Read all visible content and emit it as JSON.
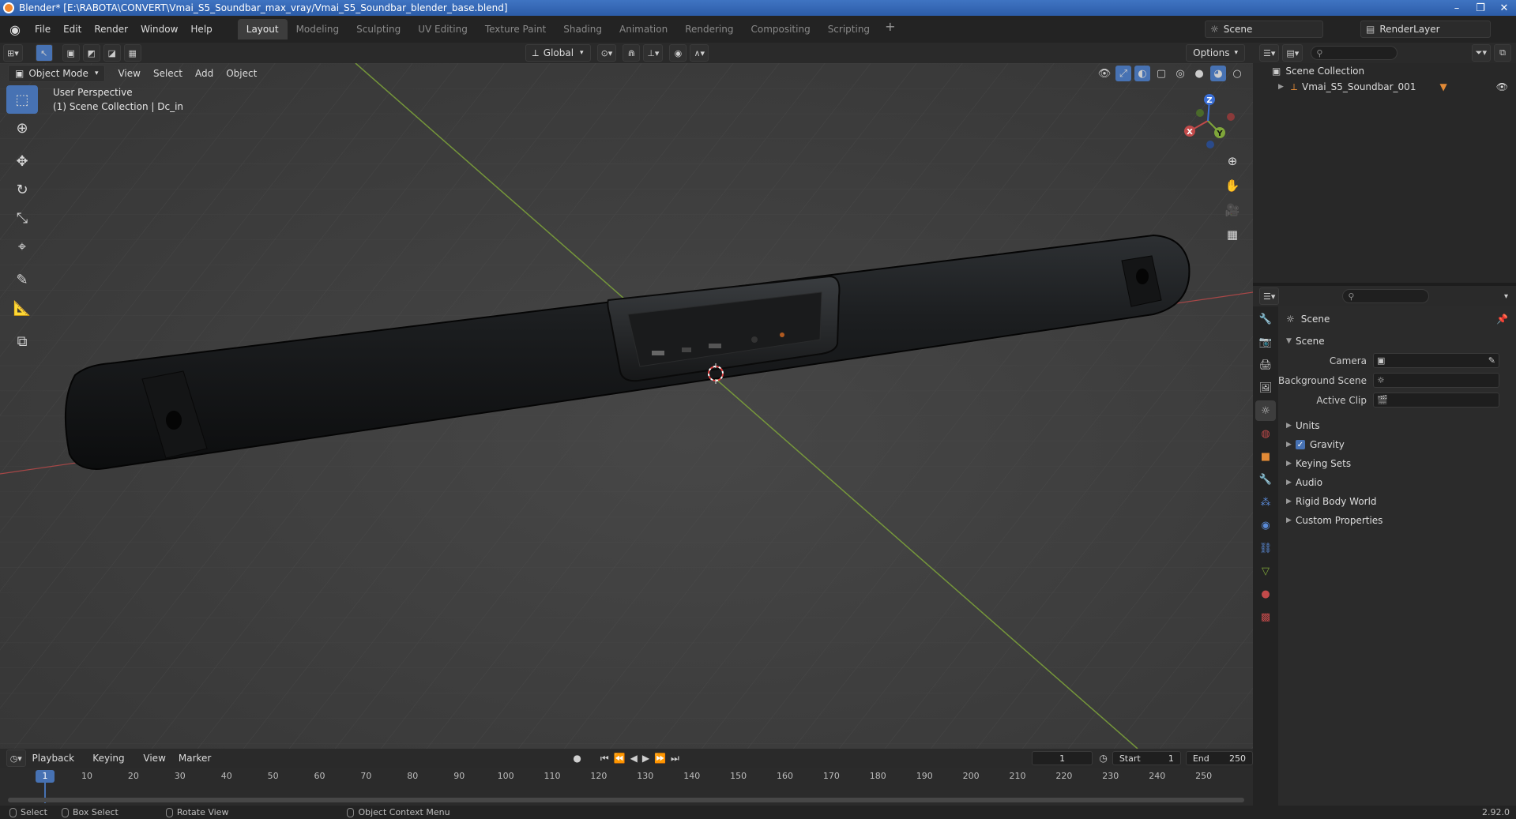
{
  "window": {
    "title": "Blender* [E:\\RABOTA\\CONVERT\\Vmai_S5_Soundbar_max_vray/Vmai_S5_Soundbar_blender_base.blend]",
    "controls": [
      "–",
      "❐",
      "✕"
    ]
  },
  "menubar": {
    "items": [
      "File",
      "Edit",
      "Render",
      "Window",
      "Help"
    ],
    "workspaces": [
      "Layout",
      "Modeling",
      "Sculpting",
      "UV Editing",
      "Texture Paint",
      "Shading",
      "Animation",
      "Rendering",
      "Compositing",
      "Scripting"
    ],
    "active_workspace": "Layout",
    "add_label": "+",
    "scene": "Scene",
    "render_layer": "RenderLayer"
  },
  "viewport_header": {
    "orientation": "Global",
    "options_label": "Options"
  },
  "viewport": {
    "mode": "Object Mode",
    "menus": [
      "View",
      "Select",
      "Add",
      "Object"
    ],
    "info_line1": "User Perspective",
    "info_line2": "(1) Scene Collection | Dc_in",
    "gizmo": {
      "x": "X",
      "y": "Y",
      "z": "Z"
    }
  },
  "outliner": {
    "collection": "Scene Collection",
    "object": "Vmai_S5_Soundbar_001"
  },
  "properties": {
    "context": "Scene",
    "panel": "Scene",
    "rows": [
      {
        "label": "Camera",
        "value": ""
      },
      {
        "label": "Background Scene",
        "value": ""
      },
      {
        "label": "Active Clip",
        "value": ""
      }
    ],
    "subpanels": [
      "Units",
      "Gravity",
      "Keying Sets",
      "Audio",
      "Rigid Body World",
      "Custom Properties"
    ],
    "gravity_checked": true
  },
  "timeline": {
    "menus": [
      "Playback",
      "Keying",
      "View",
      "Marker"
    ],
    "current_frame": "1",
    "start_label": "Start",
    "start": "1",
    "end_label": "End",
    "end": "250",
    "ticks": [
      "10",
      "20",
      "30",
      "40",
      "50",
      "60",
      "70",
      "80",
      "90",
      "100",
      "110",
      "120",
      "130",
      "140",
      "150",
      "160",
      "170",
      "180",
      "190",
      "200",
      "210",
      "220",
      "230",
      "240",
      "250"
    ]
  },
  "statusbar": {
    "select": "Select",
    "box_select": "Box Select",
    "rotate_view": "Rotate View",
    "context_menu": "Object Context Menu",
    "version": "2.92.0"
  },
  "colors": {
    "accent": "#4772b3",
    "axis_x": "#c24a4a",
    "axis_y": "#7fa63a",
    "axis_z": "#3b6fd6"
  }
}
